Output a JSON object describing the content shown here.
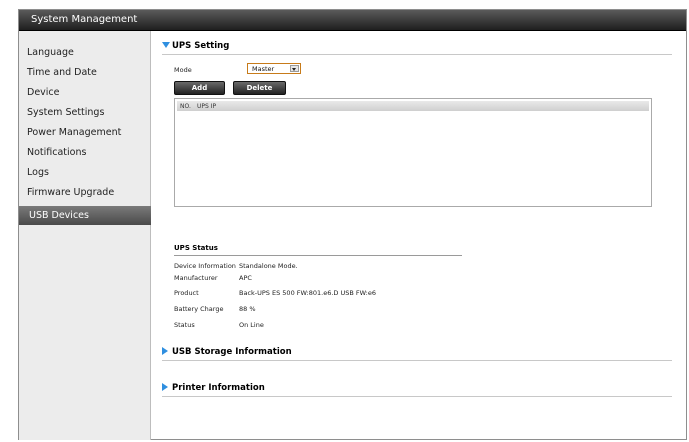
{
  "window": {
    "title": "System Management"
  },
  "sidebar": {
    "items": [
      {
        "label": "Language"
      },
      {
        "label": "Time and Date"
      },
      {
        "label": "Device"
      },
      {
        "label": "System Settings"
      },
      {
        "label": "Power Management"
      },
      {
        "label": "Notifications"
      },
      {
        "label": "Logs"
      },
      {
        "label": "Firmware Upgrade"
      },
      {
        "label": "USB Devices",
        "active": true
      }
    ]
  },
  "ups_setting": {
    "title": "UPS Setting",
    "mode_label": "Mode",
    "mode_value": "Master",
    "add_label": "Add",
    "delete_label": "Delete",
    "table_headers": [
      "NO.",
      "UPS IP"
    ]
  },
  "ups_status": {
    "title": "UPS Status",
    "rows": [
      {
        "label": "Device Information",
        "value": "Standalone Mode."
      },
      {
        "label": "Manufacturer",
        "value": "APC"
      },
      {
        "label": "Product",
        "value": "Back-UPS ES 500 FW:801.e6.D USB FW:e6"
      },
      {
        "label": "Battery Charge",
        "value": "88 %"
      },
      {
        "label": "Status",
        "value": "On Line"
      }
    ]
  },
  "usb_storage": {
    "title": "USB Storage Information"
  },
  "printer": {
    "title": "Printer Information"
  },
  "colors": {
    "accent": "#2f8fe0",
    "titlebar": "#1e1e1e",
    "select_border": "#c77b1a"
  }
}
